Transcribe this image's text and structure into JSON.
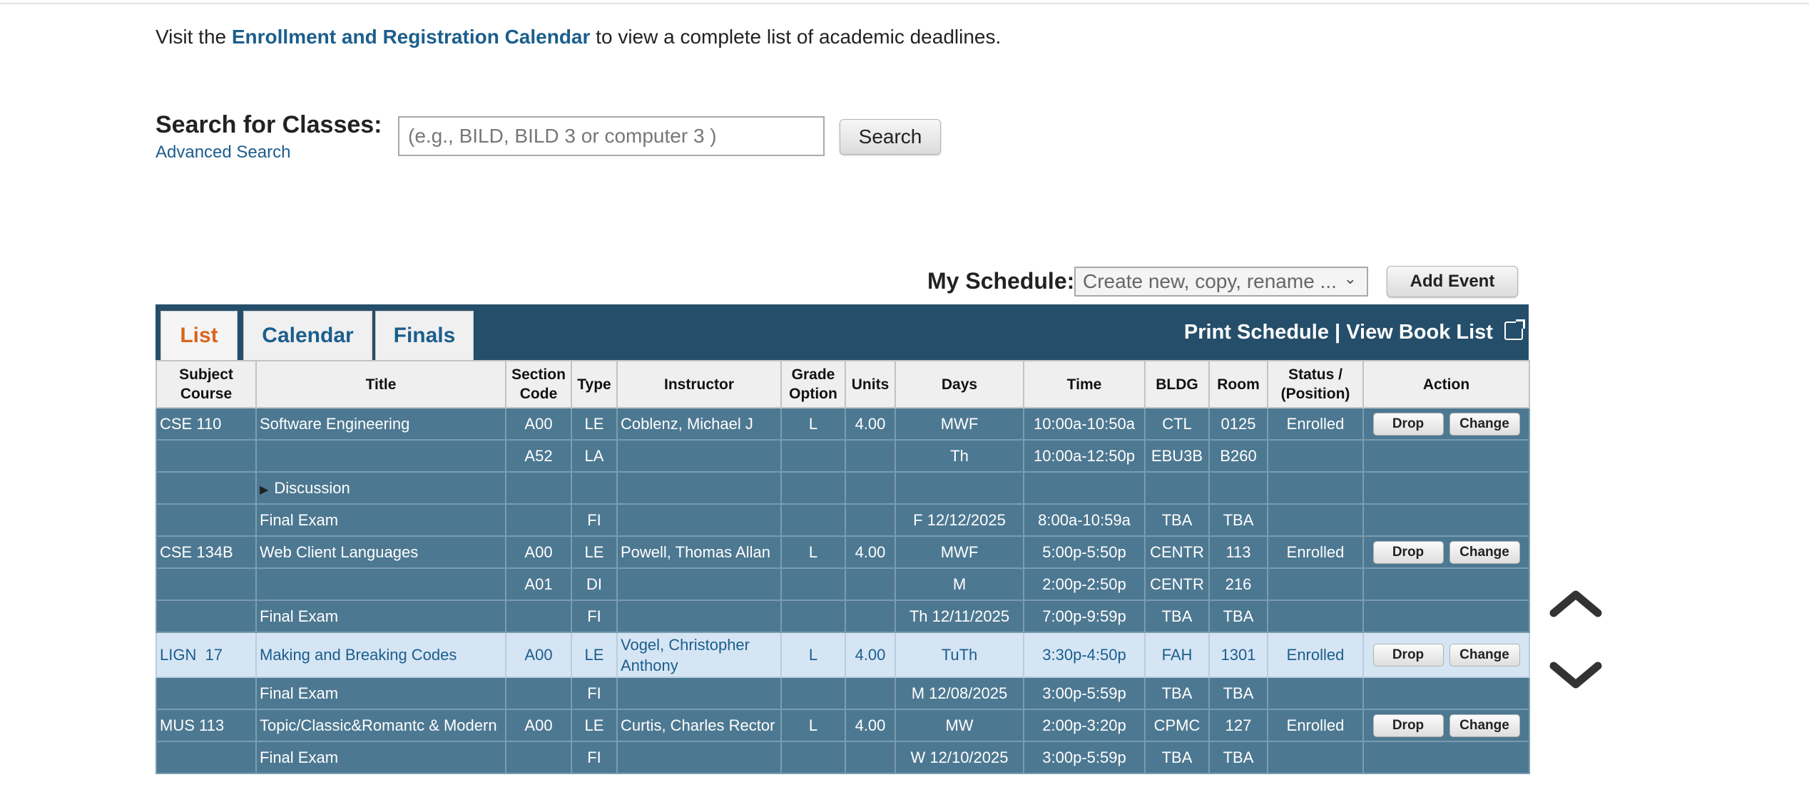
{
  "intro": {
    "before": "Visit the ",
    "link": "Enrollment and Registration Calendar",
    "after": " to view a complete list of academic deadlines."
  },
  "search": {
    "label": "Search for Classes:",
    "advanced_link": "Advanced Search",
    "placeholder": "(e.g., BILD, BILD 3 or computer 3 )",
    "button": "Search"
  },
  "schedule_bar": {
    "label": "My Schedule:",
    "select_placeholder": "Create new, copy, rename ...",
    "add_event": "Add Event"
  },
  "tabs": [
    {
      "label": "List",
      "active": true
    },
    {
      "label": "Calendar",
      "active": false
    },
    {
      "label": "Finals",
      "active": false
    }
  ],
  "print_links": {
    "print": "Print Schedule",
    "separator": "|",
    "book": "View Book List"
  },
  "table": {
    "headers": {
      "subject_l1": "Subject",
      "subject_l2": "Course",
      "title": "Title",
      "section_l1": "Section",
      "section_l2": "Code",
      "type": "Type",
      "instructor": "Instructor",
      "grade_l1": "Grade",
      "grade_l2": "Option",
      "units": "Units",
      "days": "Days",
      "time": "Time",
      "bldg": "BLDG",
      "room": "Room",
      "status_l1": "Status /",
      "status_l2": "(Position)",
      "action": "Action"
    },
    "rows": [
      {
        "course": "CSE 110",
        "title": "Software Engineering",
        "section": "A00",
        "type": "LE",
        "instructor": "Coblenz, Michael J",
        "grade": "L",
        "units": "4.00",
        "days": "MWF",
        "time": "10:00a-10:50a",
        "bldg": "CTL",
        "room": "0125",
        "status": "Enrolled"
      },
      {
        "course": "",
        "title": "",
        "section": "A52",
        "type": "LA",
        "instructor": "",
        "grade": "",
        "units": "",
        "days": "Th",
        "time": "10:00a-12:50p",
        "bldg": "EBU3B",
        "room": "B260",
        "status": ""
      },
      {
        "course": "",
        "title": "Discussion",
        "section": "",
        "type": "",
        "instructor": "",
        "grade": "",
        "units": "",
        "days": "",
        "time": "",
        "bldg": "",
        "room": "",
        "status": ""
      },
      {
        "course": "",
        "title": "Final Exam",
        "section": "",
        "type": "FI",
        "instructor": "",
        "grade": "",
        "units": "",
        "days": "F 12/12/2025",
        "time": "8:00a-10:59a",
        "bldg": "TBA",
        "room": "TBA",
        "status": ""
      },
      {
        "course": "CSE 134B",
        "title": "Web Client Languages",
        "section": "A00",
        "type": "LE",
        "instructor": "Powell, Thomas Allan",
        "grade": "L",
        "units": "4.00",
        "days": "MWF",
        "time": "5:00p-5:50p",
        "bldg": "CENTR",
        "room": "113",
        "status": "Enrolled"
      },
      {
        "course": "",
        "title": "",
        "section": "A01",
        "type": "DI",
        "instructor": "",
        "grade": "",
        "units": "",
        "days": "M",
        "time": "2:00p-2:50p",
        "bldg": "CENTR",
        "room": "216",
        "status": ""
      },
      {
        "course": "",
        "title": "Final Exam",
        "section": "",
        "type": "FI",
        "instructor": "",
        "grade": "",
        "units": "",
        "days": "Th 12/11/2025",
        "time": "7:00p-9:59p",
        "bldg": "TBA",
        "room": "TBA",
        "status": ""
      },
      {
        "course": "LIGN  17",
        "title": "Making and Breaking Codes",
        "section": "A00",
        "type": "LE",
        "instructor": "Vogel, Christopher Anthony",
        "grade": "L",
        "units": "4.00",
        "days": "TuTh",
        "time": "3:30p-4:50p",
        "bldg": "FAH",
        "room": "1301",
        "status": "Enrolled"
      },
      {
        "course": "",
        "title": "Final Exam",
        "section": "",
        "type": "FI",
        "instructor": "",
        "grade": "",
        "units": "",
        "days": "M 12/08/2025",
        "time": "3:00p-5:59p",
        "bldg": "TBA",
        "room": "TBA",
        "status": ""
      },
      {
        "course": "MUS 113",
        "title": "Topic/Classic&Romantc & Modern",
        "section": "A00",
        "type": "LE",
        "instructor": "Curtis, Charles Rector",
        "grade": "L",
        "units": "4.00",
        "days": "MW",
        "time": "2:00p-3:20p",
        "bldg": "CPMC",
        "room": "127",
        "status": "Enrolled"
      },
      {
        "course": "",
        "title": "Final Exam",
        "section": "",
        "type": "FI",
        "instructor": "",
        "grade": "",
        "units": "",
        "days": "W 12/10/2025",
        "time": "3:00p-5:59p",
        "bldg": "TBA",
        "room": "TBA",
        "status": ""
      }
    ],
    "action_labels": {
      "drop": "Drop",
      "change": "Change"
    }
  },
  "icons": {
    "scroll_up": "chevron-up-icon",
    "scroll_down": "chevron-down-icon",
    "external": "external-link-icon",
    "expand": "triangle-right-icon"
  },
  "colors": {
    "link": "#1b5e8c",
    "tab_bar": "#254e6a",
    "row": "#4d7891",
    "highlight_row": "#d6e5f4",
    "active_tab": "#d8661c"
  }
}
